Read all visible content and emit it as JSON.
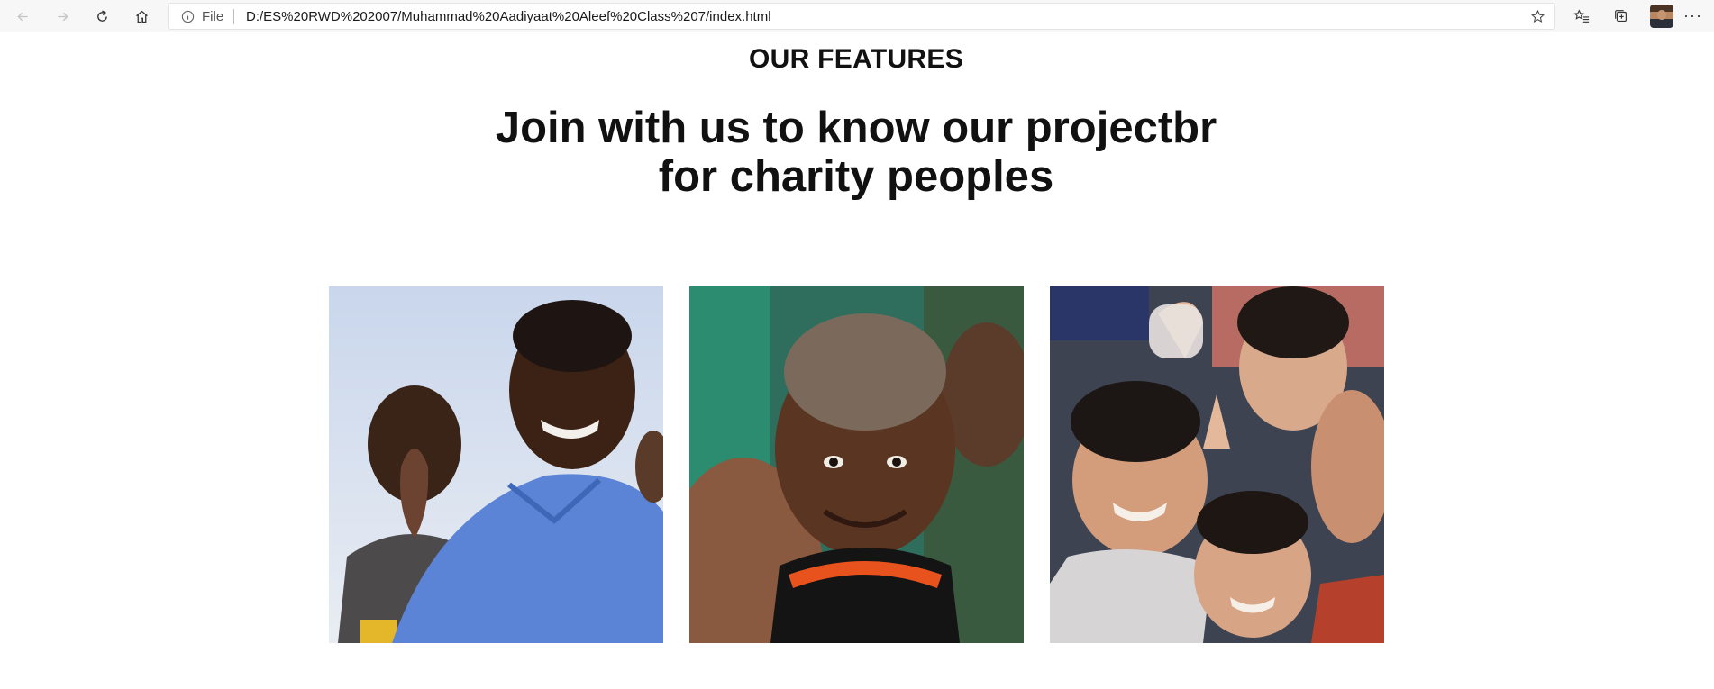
{
  "browser": {
    "scheme_label": "File",
    "url": "D:/ES%20RWD%202007/Muhammad%20Aadiyaat%20Aleef%20Class%207/index.html",
    "icons": [
      "back-icon",
      "forward-icon",
      "refresh-icon",
      "home-icon",
      "info-icon",
      "star-icon",
      "favorites-icon",
      "collections-icon",
      "profile-avatar",
      "more-icon"
    ]
  },
  "content": {
    "eyebrow": "OUR FEATURES",
    "headline_line1": "Join with us to know our projectbr",
    "headline_line2": "for charity peoples"
  },
  "gallery": {
    "photos": [
      {
        "name": "photo-children-blue-shirts"
      },
      {
        "name": "photo-smiling-boy"
      },
      {
        "name": "photo-group-of-children"
      }
    ]
  },
  "colors": {
    "toolbar_bg": "#f7f7f7",
    "text": "#111111"
  }
}
